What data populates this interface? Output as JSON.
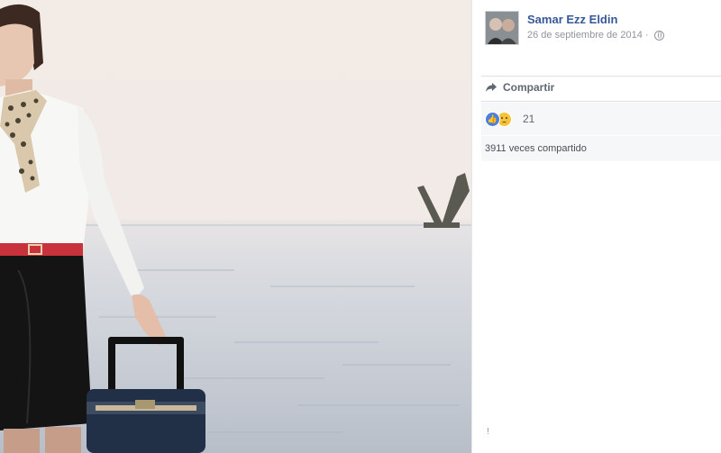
{
  "post": {
    "author": "Samar Ezz Eldin",
    "date": "26 de septiembre de 2014 ·",
    "privacy_icon": "globe-icon"
  },
  "actions": {
    "share_label": "Compartir",
    "share_icon": "share-arrow-icon"
  },
  "reactions": {
    "icons": [
      "like-icon",
      "sad-icon"
    ],
    "count": "21"
  },
  "shares": {
    "label": "3911 veces compartido"
  },
  "footer_mark": "!",
  "colors": {
    "link_blue": "#365899",
    "muted_gray": "#90949c",
    "panel_bg": "#f6f7f9",
    "belt_red": "#c8323c"
  }
}
